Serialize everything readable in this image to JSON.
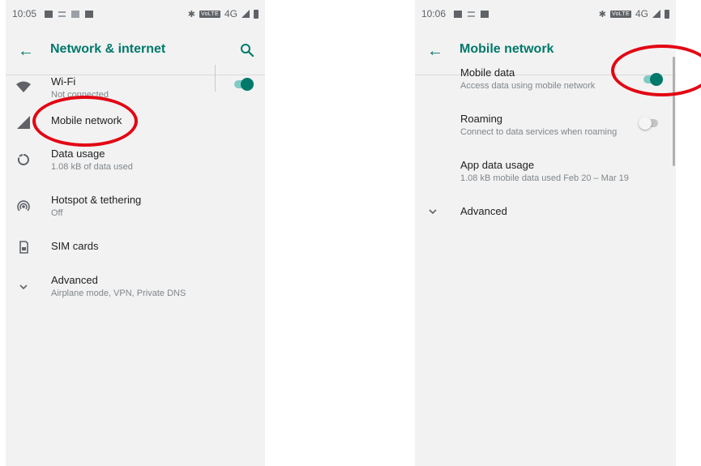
{
  "left": {
    "status": {
      "time": "10:05",
      "network": "4G"
    },
    "appbar": {
      "title": "Network & internet"
    },
    "items": [
      {
        "title": "Wi-Fi",
        "subtitle": "Not connected",
        "icon": "wifi-icon",
        "toggle": "on"
      },
      {
        "title": "Mobile network",
        "icon": "signal-icon"
      },
      {
        "title": "Data usage",
        "subtitle": "1.08 kB of data used",
        "icon": "data-usage-icon"
      },
      {
        "title": "Hotspot & tethering",
        "subtitle": "Off",
        "icon": "hotspot-icon"
      },
      {
        "title": "SIM cards",
        "icon": "sim-card-icon"
      },
      {
        "title": "Advanced",
        "subtitle": "Airplane mode, VPN, Private DNS",
        "icon": "chevron-down-icon"
      }
    ]
  },
  "right": {
    "status": {
      "time": "10:06",
      "network": "4G"
    },
    "appbar": {
      "title": "Mobile network"
    },
    "items": [
      {
        "title": "Mobile data",
        "subtitle": "Access data using mobile network",
        "toggle": "on"
      },
      {
        "title": "Roaming",
        "subtitle": "Connect to data services when roaming",
        "toggle": "off"
      },
      {
        "title": "App data usage",
        "subtitle": "1.08 kB mobile data used Feb 20 – Mar 19"
      },
      {
        "title": "Advanced",
        "icon": "chevron-down-icon"
      }
    ]
  },
  "colors": {
    "accent": "#00796b",
    "annotation": "#e30613",
    "background": "#f2f2f2"
  }
}
